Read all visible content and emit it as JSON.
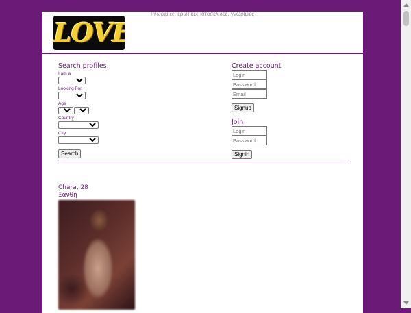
{
  "header": {
    "logo_text": "LOVE",
    "tagline": "Γνωριμίες, ερωτικές ιστοσελίδες, γνωριμίες"
  },
  "search": {
    "title": "Search profiles",
    "iam_label": "I am a",
    "looking_for_label": "Looking For",
    "age_label": "Age",
    "country_label": "Country",
    "city_label": "City",
    "button": "Search"
  },
  "create_account": {
    "title": "Create account",
    "login_placeholder": "Login",
    "password_placeholder": "Password",
    "email_placeholder": "Email",
    "button": "Signup"
  },
  "join": {
    "title": "Join",
    "login_placeholder": "Login",
    "password_placeholder": "Password",
    "button": "Signin"
  },
  "profile": {
    "name": "Chara, 28",
    "city": "Ξάνθη"
  },
  "colors": {
    "brand": "#6b1a78",
    "background": "#6b1a78"
  }
}
